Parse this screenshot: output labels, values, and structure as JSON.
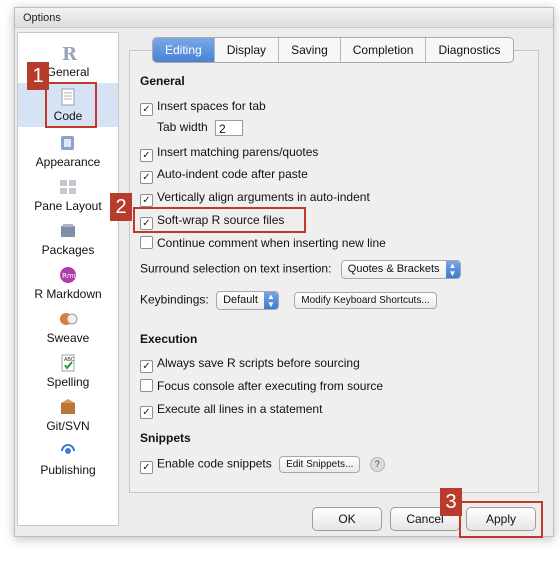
{
  "window": {
    "title": "Options"
  },
  "sidebar": {
    "items": [
      {
        "label": "General",
        "icon": "r-logo-icon"
      },
      {
        "label": "Code",
        "icon": "document-icon"
      },
      {
        "label": "Appearance",
        "icon": "appearance-icon"
      },
      {
        "label": "Pane Layout",
        "icon": "pane-layout-icon"
      },
      {
        "label": "Packages",
        "icon": "packages-icon"
      },
      {
        "label": "R Markdown",
        "icon": "rmd-icon"
      },
      {
        "label": "Sweave",
        "icon": "sweave-icon"
      },
      {
        "label": "Spelling",
        "icon": "spelling-icon"
      },
      {
        "label": "Git/SVN",
        "icon": "git-box-icon"
      },
      {
        "label": "Publishing",
        "icon": "publishing-icon"
      }
    ]
  },
  "tabs": [
    "Editing",
    "Display",
    "Saving",
    "Completion",
    "Diagnostics"
  ],
  "general": {
    "heading": "General",
    "insert_spaces": "Insert spaces for tab",
    "tab_width_label": "Tab width",
    "tab_width_value": "2",
    "insert_matching": "Insert matching parens/quotes",
    "auto_indent": "Auto-indent code after paste",
    "vertically_align": "Vertically align arguments in auto-indent",
    "soft_wrap": "Soft-wrap R source files",
    "continue_comment": "Continue comment when inserting new line",
    "surround_label": "Surround selection on text insertion:",
    "surround_value": "Quotes & Brackets",
    "keybindings_label": "Keybindings:",
    "keybindings_value": "Default",
    "modify_shortcuts": "Modify Keyboard Shortcuts..."
  },
  "execution": {
    "heading": "Execution",
    "always_save": "Always save R scripts before sourcing",
    "focus_console": "Focus console after executing from source",
    "execute_all": "Execute all lines in a statement"
  },
  "snippets": {
    "heading": "Snippets",
    "enable": "Enable code snippets",
    "edit_button": "Edit Snippets...",
    "help": "?"
  },
  "footer": {
    "ok": "OK",
    "cancel": "Cancel",
    "apply": "Apply"
  },
  "annotations": {
    "one": "1",
    "two": "2",
    "three": "3"
  },
  "checkmark": "✓",
  "colors": {
    "accent": "#4a82d4",
    "highlight": "#c0392b"
  }
}
